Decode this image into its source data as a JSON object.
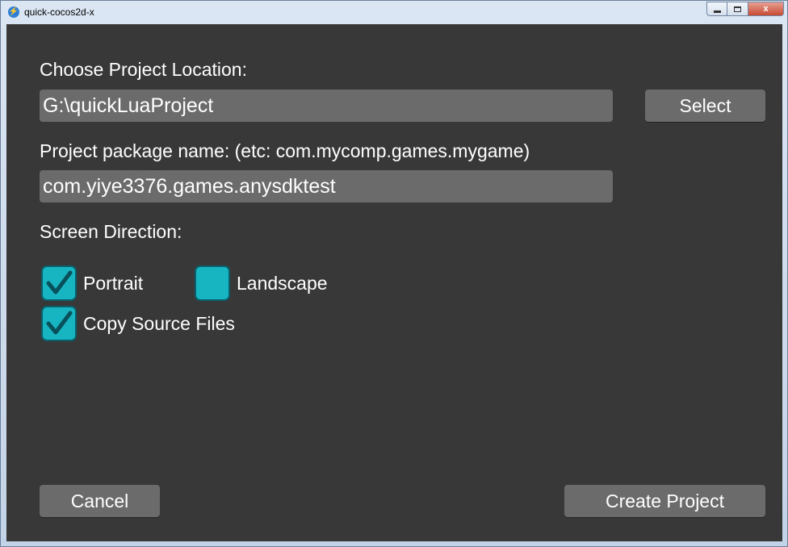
{
  "window": {
    "title": "quick-cocos2d-x",
    "controls": {
      "minimize": "",
      "maximize": "",
      "close": "x"
    }
  },
  "form": {
    "location_label": "Choose Project Location:",
    "location_value": "G:\\quickLuaProject",
    "select_label": "Select",
    "package_label": "Project package name: (etc: com.mycomp.games.mygame)",
    "package_value": "com.yiye3376.games.anysdktest",
    "direction_label": "Screen Direction:",
    "portrait_label": "Portrait",
    "portrait_checked": true,
    "landscape_label": "Landscape",
    "landscape_checked": false,
    "copy_source_label": "Copy Source Files",
    "copy_source_checked": true
  },
  "footer": {
    "cancel_label": "Cancel",
    "create_label": "Create Project"
  },
  "colors": {
    "background": "#383838",
    "field": "#6b6b6b",
    "checkbox": "#17b5c2",
    "checkbox_border": "#0a5f6c",
    "text": "#ffffff"
  }
}
